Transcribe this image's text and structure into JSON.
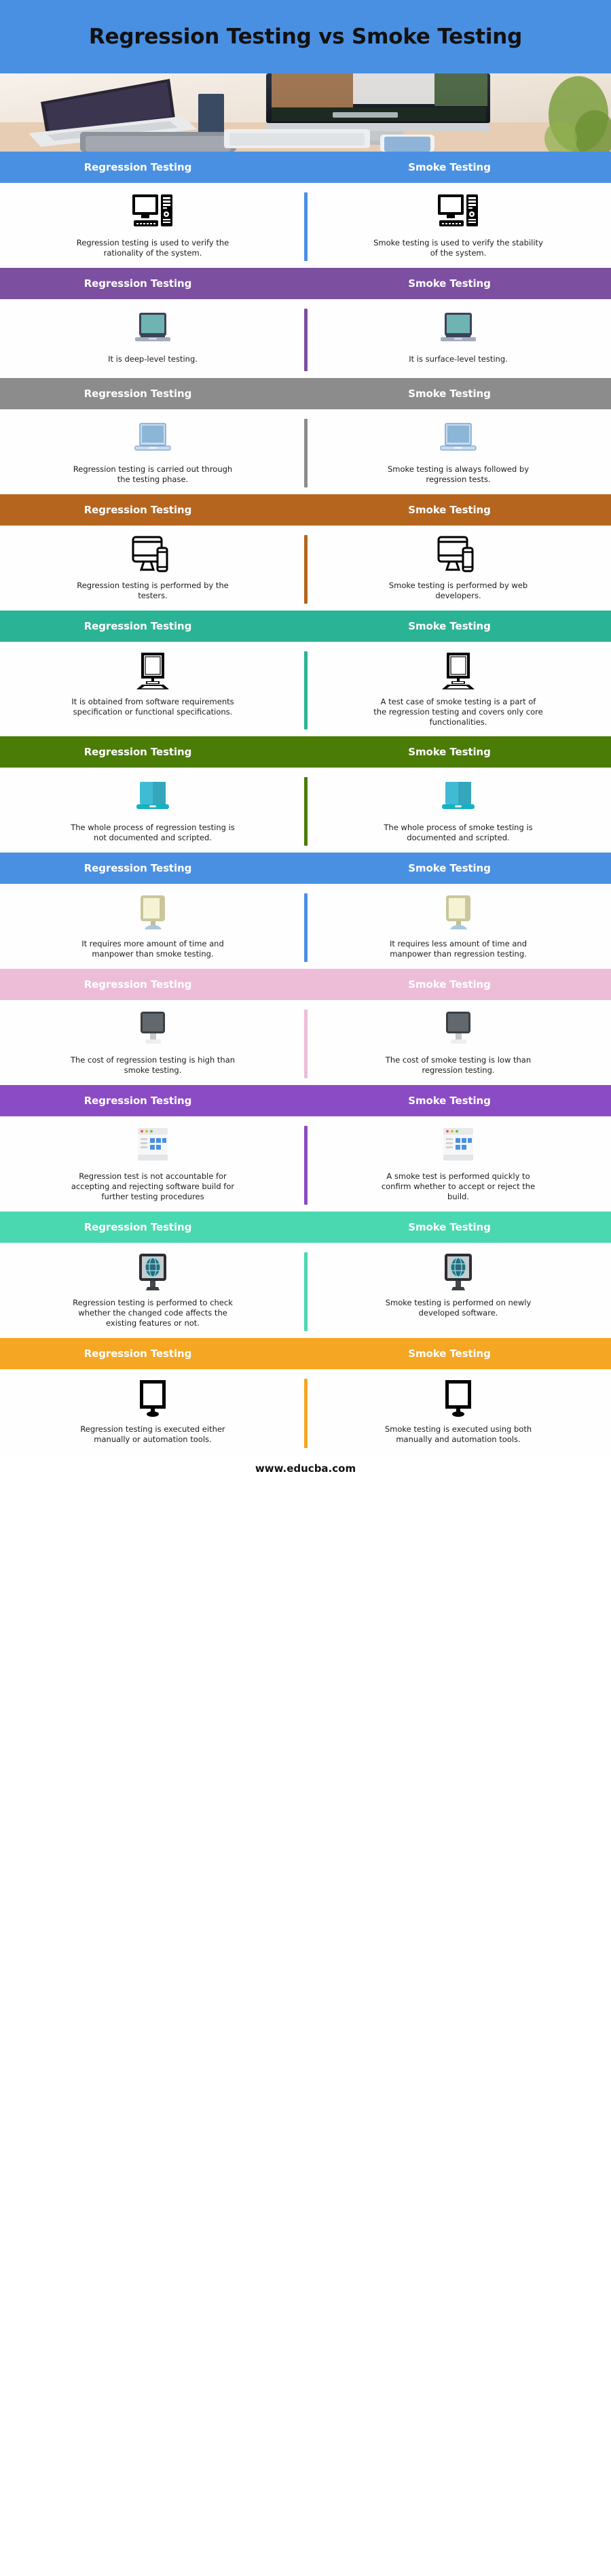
{
  "title": "Regression Testing vs Smoke Testing",
  "hero": {
    "alt": "desk-workspace-photo"
  },
  "column_labels": {
    "left": "Regression Testing",
    "right": "Smoke Testing"
  },
  "footer": {
    "url": "www.educba.com"
  },
  "colors": {
    "title_bar": "#4a90e2",
    "band_1": "#4a90e2",
    "band_2": "#7c4fa0",
    "band_3": "#8c8c8c",
    "band_4": "#b5651d",
    "band_5": "#2bb396",
    "band_6": "#4a7c06",
    "band_7": "#4a90e2",
    "band_8": "#edbdd8",
    "band_9": "#8b4bc4",
    "band_10": "#4ad8b0",
    "band_11": "#f5a623",
    "text_white": "#ffffff",
    "text_dark": "#1b1b1b"
  },
  "rows": [
    {
      "band_color": "#4a90e2",
      "divider_color": "#4a90e2",
      "icon": "desktop-tower-icon",
      "left_text": "Regression testing is used to verify the rationality of the system.",
      "right_text": "Smoke testing is used to verify the stability of the system."
    },
    {
      "band_color": "#7c4fa0",
      "divider_color": "#7c4fa0",
      "icon": "laptop-teal-icon",
      "left_text": "It is deep-level testing.",
      "right_text": "It is surface-level testing."
    },
    {
      "band_color": "#8c8c8c",
      "divider_color": "#8c8c8c",
      "icon": "laptop-blue-icon",
      "left_text": "Regression testing is carried out through the testing phase.",
      "right_text": "Smoke testing is always followed by regression tests."
    },
    {
      "band_color": "#b5651d",
      "divider_color": "#b5651d",
      "icon": "monitor-phone-icon",
      "left_text": "Regression testing is performed by the testers.",
      "right_text": "Smoke testing is performed by web developers."
    },
    {
      "band_color": "#2bb396",
      "divider_color": "#2bb396",
      "icon": "monitor-keyboard-icon",
      "left_text": "It is obtained from software requirements specification or functional specifications.",
      "right_text": "A test case of smoke testing is a part of the regression testing and covers only core functionalities."
    },
    {
      "band_color": "#4a7c06",
      "divider_color": "#4a7c06",
      "icon": "laptop-cyan-icon",
      "left_text": "The whole process of regression testing is not documented and scripted.",
      "right_text": "The whole process of smoke testing is documented and scripted."
    },
    {
      "band_color": "#4a90e2",
      "divider_color": "#4a90e2",
      "icon": "crt-monitor-cream-icon",
      "left_text": "It requires more amount of time and manpower than smoke testing.",
      "right_text": "It requires less amount of time and manpower than regression testing."
    },
    {
      "band_color": "#edbdd8",
      "divider_color": "#edbdd8",
      "icon": "monitor-dark-icon",
      "left_text": "The cost of regression testing is high than smoke testing.",
      "right_text": "The cost of smoke testing is low than regression testing."
    },
    {
      "band_color": "#8b4bc4",
      "divider_color": "#8b4bc4",
      "icon": "browser-window-icon",
      "left_text": "Regression test is not accountable for accepting and rejecting software build for further testing procedures",
      "right_text": "A smoke test is performed quickly to confirm whether to accept or reject the build."
    },
    {
      "band_color": "#4ad8b0",
      "divider_color": "#4ad8b0",
      "icon": "globe-monitor-icon",
      "left_text": "Regression testing is performed to check whether the changed code affects the existing features or not.",
      "right_text": "Smoke testing is performed on newly developed software."
    },
    {
      "band_color": "#f5a623",
      "divider_color": "#f5a623",
      "icon": "monitor-outline-icon",
      "left_text": "Regression testing is executed either manually or automation tools.",
      "right_text": "Smoke testing is executed using both manually and automation tools."
    }
  ]
}
